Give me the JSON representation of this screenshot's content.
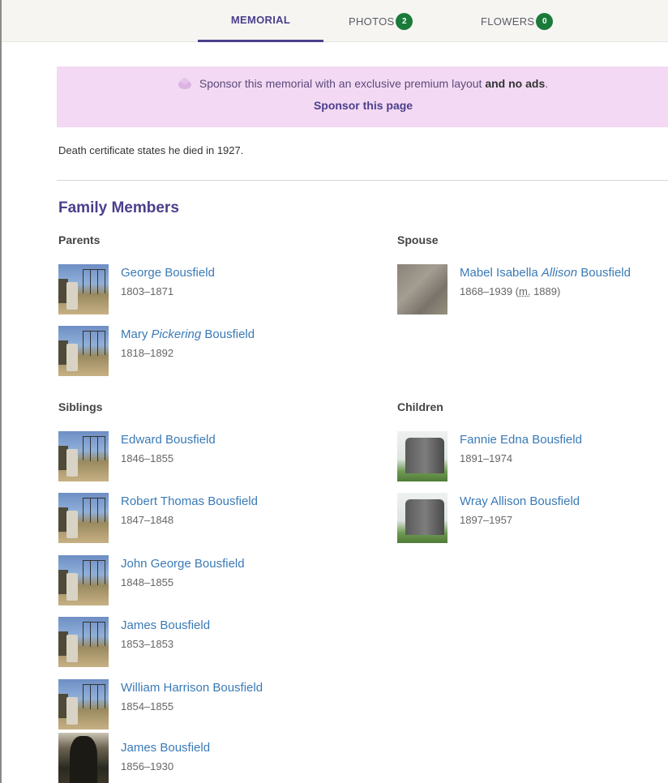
{
  "tabs": [
    {
      "label": "MEMORIAL"
    },
    {
      "label": "PHOTOS",
      "count": "2"
    },
    {
      "label": "FLOWERS",
      "count": "0"
    }
  ],
  "sponsor": {
    "text": "Sponsor this memorial with an exclusive premium layout",
    "text_bold": "and no ads",
    "text_end": ".",
    "link": "Sponsor this page"
  },
  "note": "Death certificate states he died in 1927.",
  "family": {
    "title": "Family Members",
    "parents_label": "Parents",
    "spouse_label": "Spouse",
    "siblings_label": "Siblings",
    "children_label": "Children",
    "parents": [
      {
        "name": "George Bousfield",
        "dates": "1803–1871"
      },
      {
        "name_before": "Mary",
        "name_italic": "Pickering",
        "name_after": "Bousfield",
        "dates": "1818–1892"
      }
    ],
    "spouse": [
      {
        "name_before": "Mabel Isabella",
        "name_italic": "Allison",
        "name_after": "Bousfield",
        "dates": "1868–1939 (",
        "marriage_abbr": "m.",
        "marriage_year": " 1889)"
      }
    ],
    "siblings": [
      {
        "name": "Edward Bousfield",
        "dates": "1846–1855"
      },
      {
        "name": "Robert Thomas Bousfield",
        "dates": "1847–1848"
      },
      {
        "name": "John George Bousfield",
        "dates": "1848–1855"
      },
      {
        "name": "James Bousfield",
        "dates": "1853–1853"
      },
      {
        "name": "William Harrison Bousfield",
        "dates": "1854–1855"
      },
      {
        "name": "James Bousfield",
        "dates": "1856–1930"
      }
    ],
    "children": [
      {
        "name": "Fannie Edna Bousfield",
        "dates": "1891–1974"
      },
      {
        "name": "Wray Allison Bousfield",
        "dates": "1897–1957"
      }
    ]
  }
}
